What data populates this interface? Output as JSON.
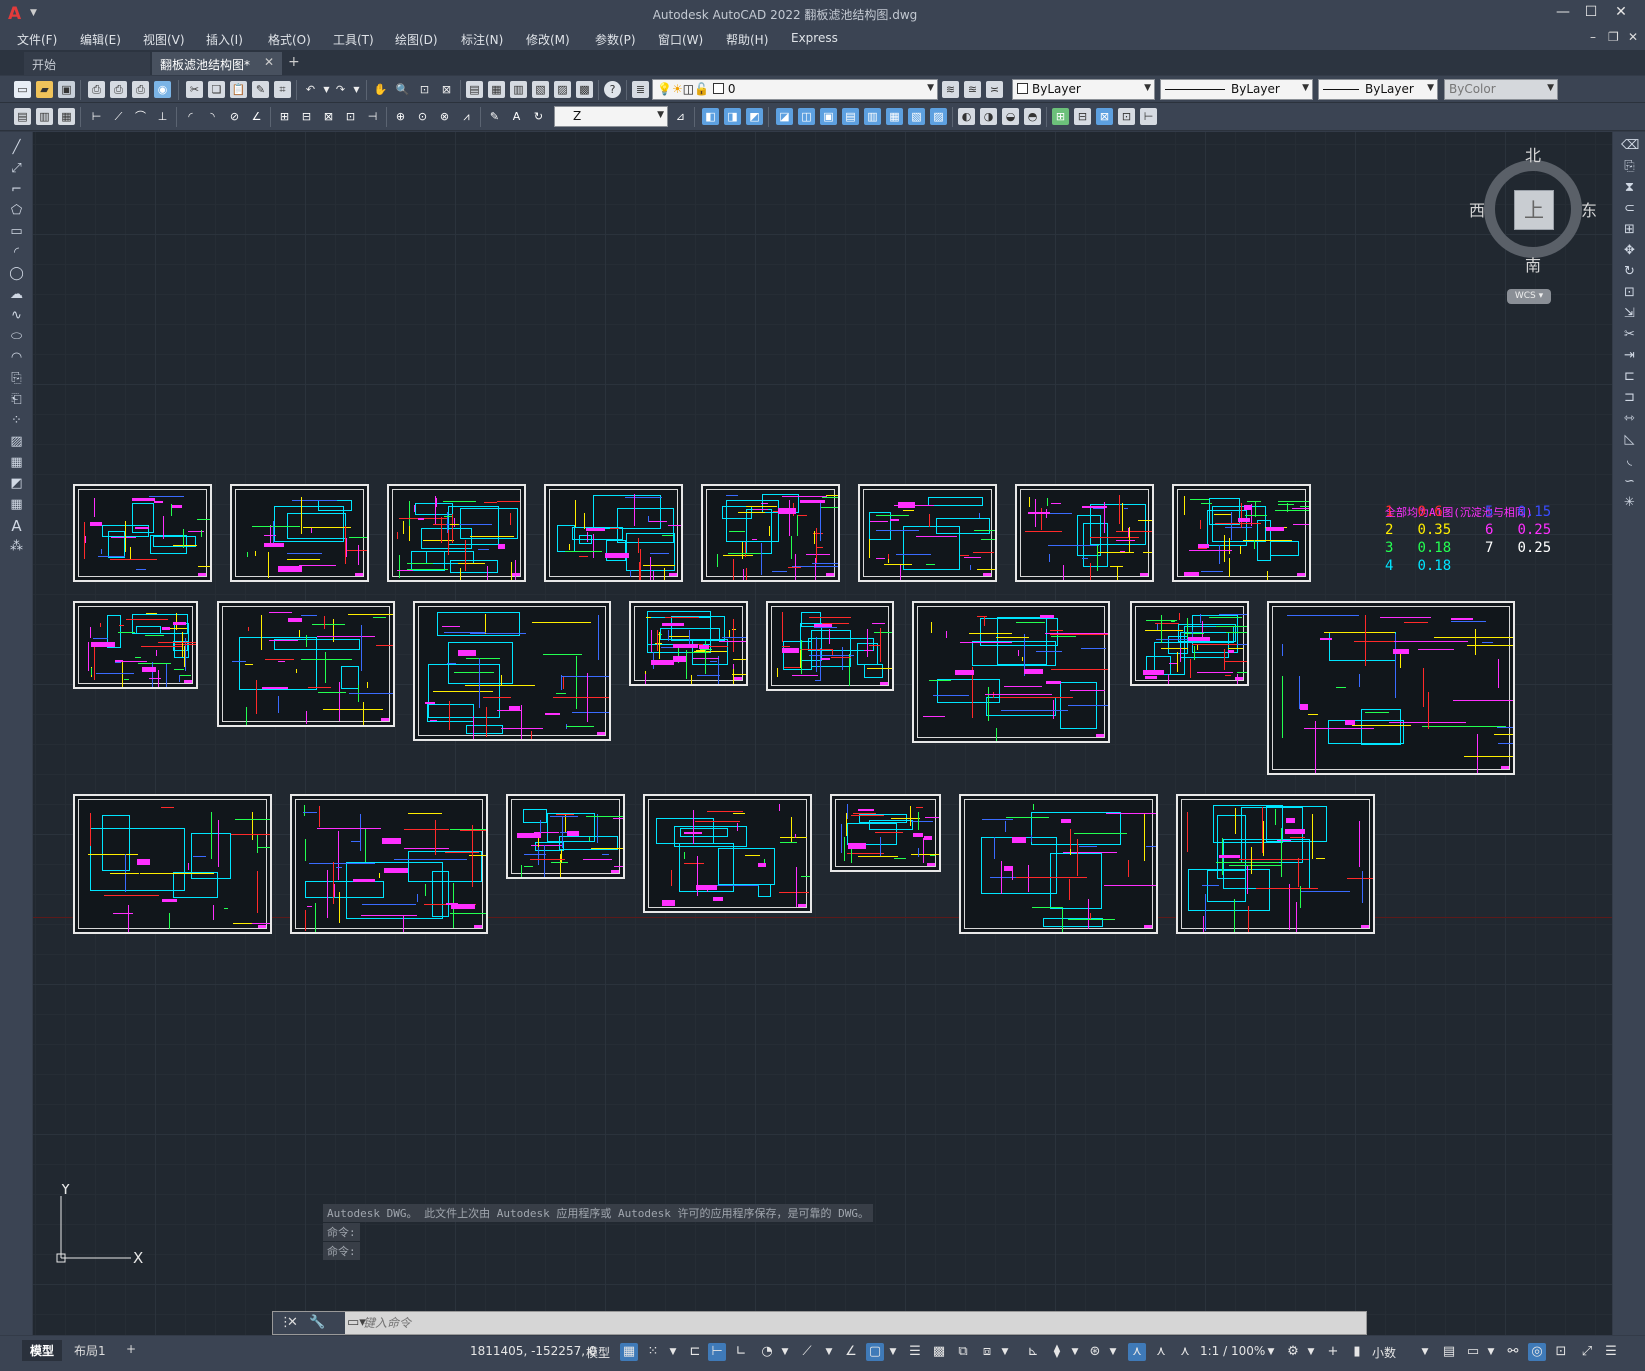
{
  "titlebar": {
    "app_title": "Autodesk AutoCAD 2022    翻板滤池结构图.dwg",
    "logo": "A"
  },
  "menu": [
    "文件(F)",
    "编辑(E)",
    "视图(V)",
    "插入(I)",
    "格式(O)",
    "工具(T)",
    "绘图(D)",
    "标注(N)",
    "修改(M)",
    "参数(P)",
    "窗口(W)",
    "帮助(H)",
    "Express"
  ],
  "tabs": {
    "start": "开始",
    "file": "翻板滤池结构图*",
    "close": "✕",
    "add": "+"
  },
  "toolbar": {
    "layer_value": "0",
    "color_value": "ByLayer",
    "linetype_value": "ByLayer",
    "lineweight_value": "ByLayer",
    "plotstyle_value": "ByColor",
    "dimstyle_value": "Z"
  },
  "viewcube": {
    "north": "北",
    "south": "南",
    "east": "东",
    "west": "西",
    "top": "上",
    "wcs": "WCS"
  },
  "legend": {
    "title": "全部均为A1图(沉淀池与相同)",
    "rows": [
      {
        "n": "1",
        "v": "0.6",
        "color": "#ff2a2a"
      },
      {
        "n": "2",
        "v": "0.35",
        "color": "#ffee00"
      },
      {
        "n": "3",
        "v": "0.18",
        "color": "#23ff50"
      },
      {
        "n": "4",
        "v": "0.18",
        "color": "#00e5ff"
      },
      {
        "n": "5",
        "v": "0.15",
        "color": "#3a4cff"
      },
      {
        "n": "6",
        "v": "0.25",
        "color": "#ff2fff"
      },
      {
        "n": "7",
        "v": "0.25",
        "color": "#ffffff"
      }
    ]
  },
  "ucs": {
    "x": "X",
    "y": "Y"
  },
  "command": {
    "history": [
      "Autodesk DWG。  此文件上次由 Autodesk 应用程序或 Autodesk 许可的应用程序保存，是可靠的 DWG。",
      "命令:",
      "命令:"
    ],
    "placeholder": "键入命令"
  },
  "status": {
    "model_tab": "模型",
    "layout_tab": "布局1",
    "add": "+",
    "coords": "1811405, -152257, 0",
    "model": "模型",
    "scale": "1:1 / 100%",
    "units": "小数"
  }
}
